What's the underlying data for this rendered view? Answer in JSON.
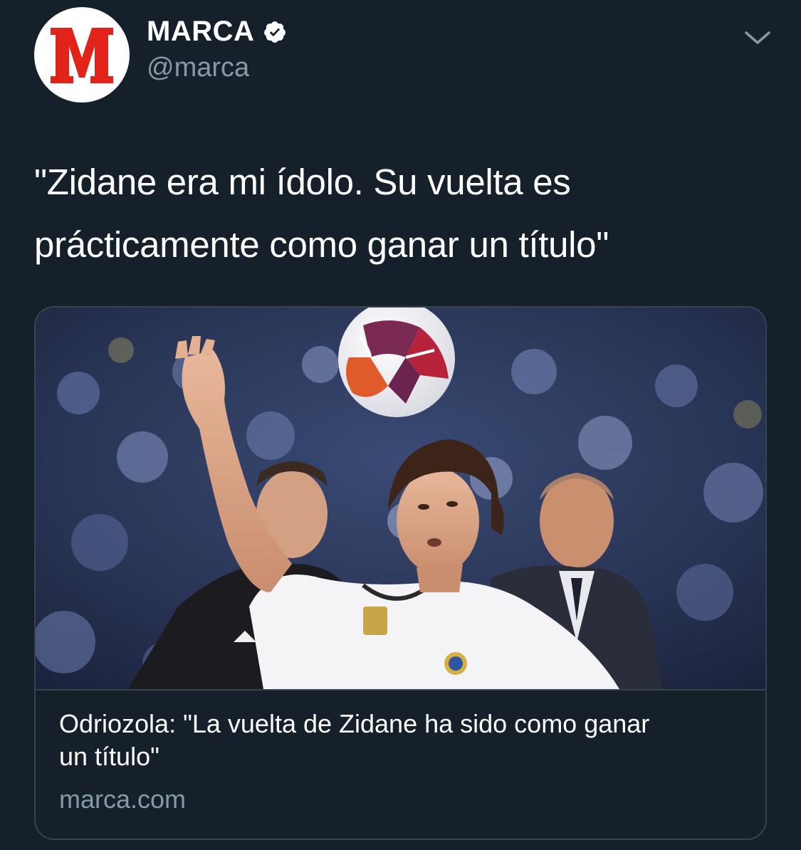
{
  "account": {
    "display_name": "MARCA",
    "handle": "@marca",
    "verified": true,
    "avatar_letter": "M"
  },
  "tweet": {
    "text_line1": "\"Zidane era mi ídolo. Su vuelta es",
    "text_line2": "prácticamente como ganar un título\""
  },
  "card": {
    "title_line1": "Odriozola: \"La vuelta de Zidane ha sido como ganar",
    "title_line2": "un título\"",
    "domain": "marca.com"
  },
  "icons": {
    "verified": "verified-badge-icon",
    "menu": "chevron-down-icon"
  },
  "colors": {
    "background": "#15202b",
    "secondary_text": "#8899a6",
    "border": "#38444d",
    "brand_red": "#e2231a"
  }
}
